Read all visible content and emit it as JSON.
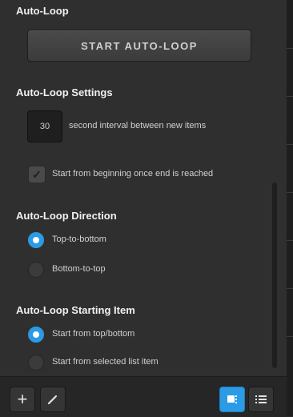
{
  "auto_loop": {
    "heading": "Auto-Loop",
    "start_button": "START AUTO-LOOP"
  },
  "settings": {
    "heading": "Auto-Loop Settings",
    "interval_value": "30",
    "interval_label": "second interval between new items",
    "restart_checkbox_label": "Start from beginning once end is reached",
    "restart_checked": true
  },
  "direction": {
    "heading": "Auto-Loop Direction",
    "options": [
      {
        "label": "Top-to-bottom",
        "selected": true
      },
      {
        "label": "Bottom-to-top",
        "selected": false
      }
    ]
  },
  "starting_item": {
    "heading": "Auto-Loop Starting Item",
    "options": [
      {
        "label": "Start from top/bottom",
        "selected": true
      },
      {
        "label": "Start from selected list item",
        "selected": false
      }
    ]
  },
  "footer": {
    "add_icon": "plus-icon",
    "edit_icon": "brush-icon",
    "grid_view_icon": "grid-view-icon",
    "list_view_icon": "list-view-icon"
  },
  "colors": {
    "accent": "#2a9be4",
    "panel": "#2f2f2f",
    "text": "#d6d6d6"
  }
}
